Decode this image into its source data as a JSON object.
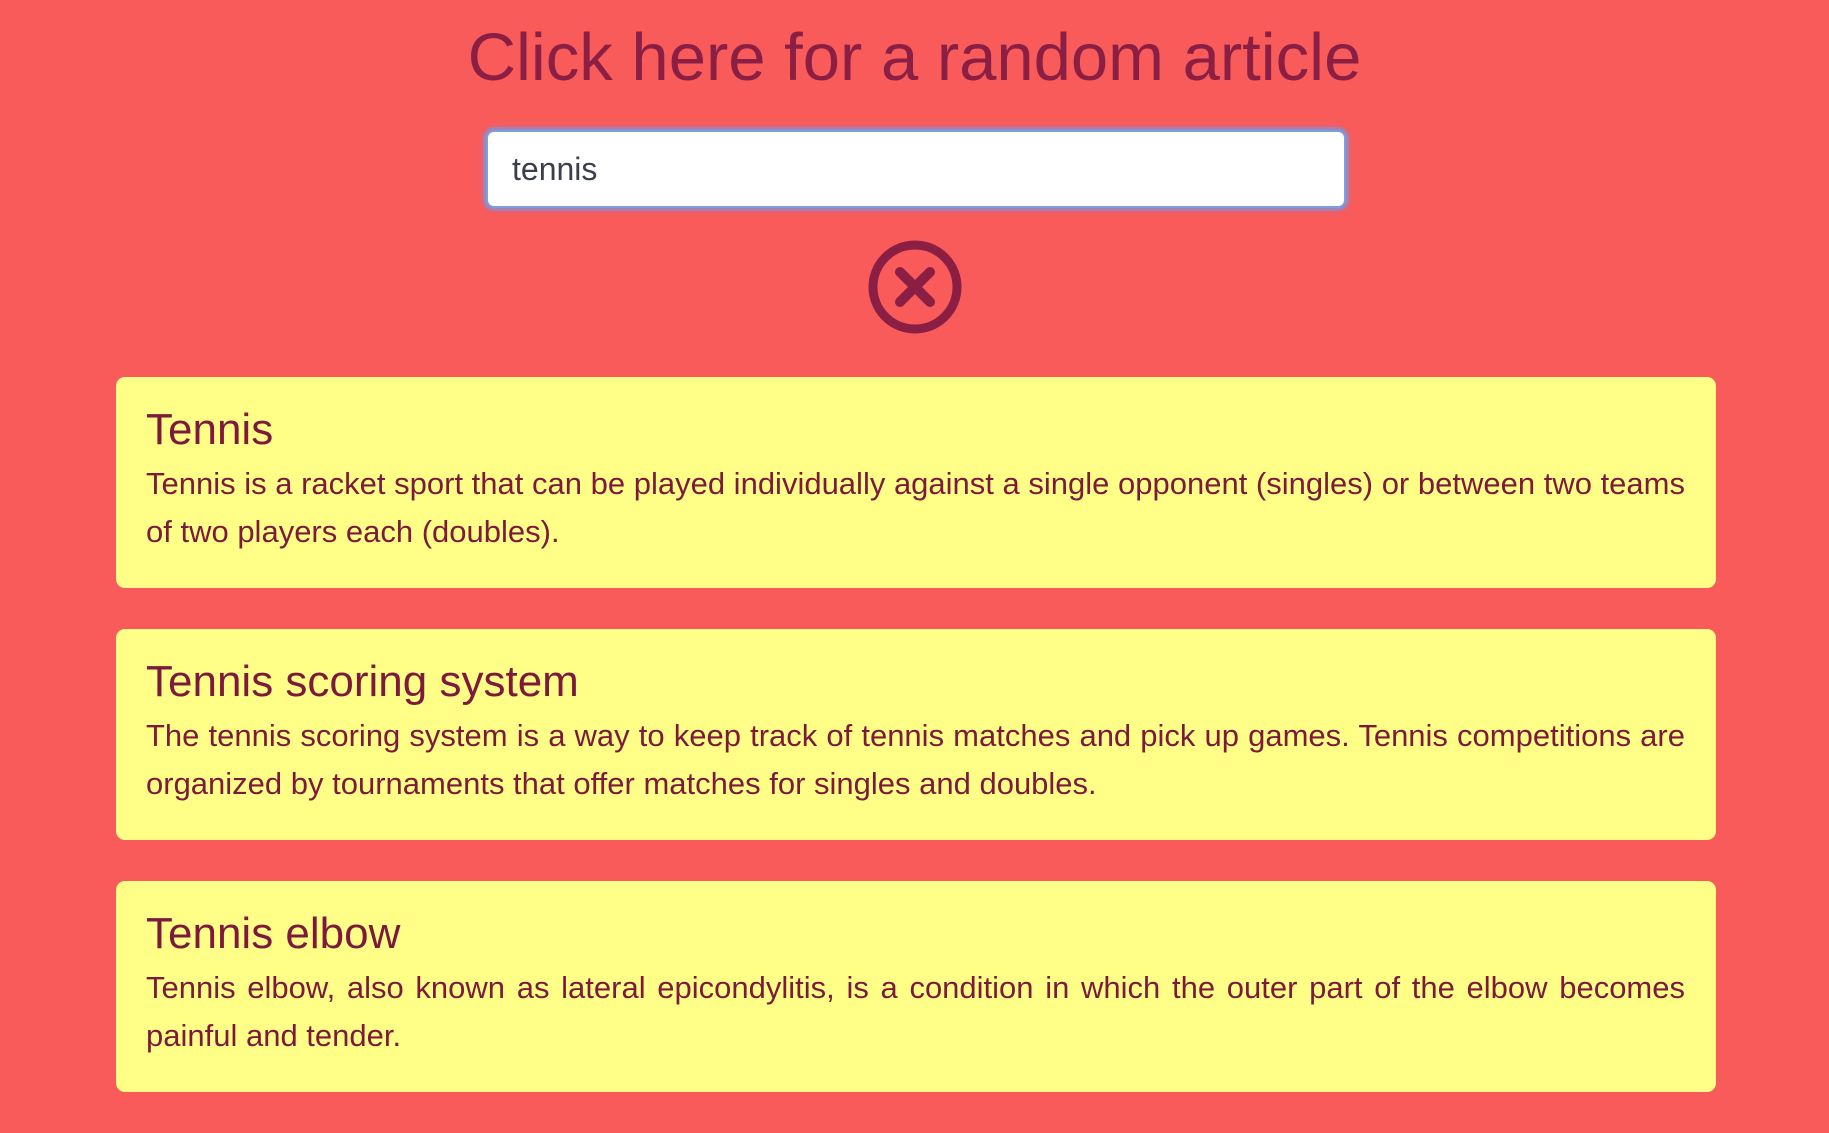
{
  "header": {
    "random_link_label": "Click here for a random article"
  },
  "search": {
    "value": "tennis",
    "placeholder": "",
    "clear_icon": "circle-x-icon"
  },
  "colors": {
    "background": "#f95b5b",
    "card_background": "#ffff88",
    "text": "#7d1a3c",
    "focus_ring": "#7aa0de"
  },
  "results": [
    {
      "title": "Tennis",
      "snippet": "Tennis is a racket sport that can be played individually against a single opponent (singles) or between two teams of two players each (doubles)."
    },
    {
      "title": "Tennis scoring system",
      "snippet": "The tennis scoring system is a way to keep track of tennis matches and pick up games. Tennis competitions are organized by tournaments that offer matches for singles and doubles."
    },
    {
      "title": "Tennis elbow",
      "snippet": "Tennis elbow, also known as lateral epicondylitis, is a condition in which the outer part of the elbow becomes painful and tender."
    }
  ]
}
